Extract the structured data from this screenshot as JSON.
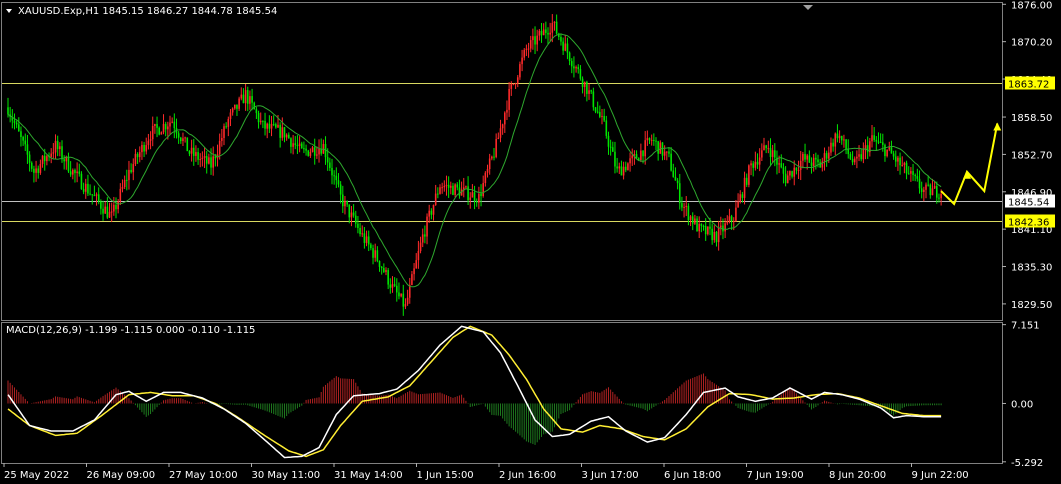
{
  "header": {
    "symbol_line": "XAUUSD.Exp,H1  1845.15 1846.27 1844.78 1845.54",
    "indicator_line": "MACD(12,26,9) -1.199 -1.115 0.000 -0.110 -1.115"
  },
  "colors": {
    "background": "#000000",
    "bull": "#ff2a2a",
    "bear": "#00e600",
    "ma": "#2ea82e",
    "level": "#d8d860",
    "current": "#c0c0c0",
    "arrow": "#ffff00",
    "macd_line": "#ffffff",
    "signal_line": "#ffee33",
    "hist_pos": "#b22222",
    "hist_neg": "#1e7a1e"
  },
  "chart_data": {
    "type": "candlestick",
    "price_axis": {
      "ticks": [
        "1876.00",
        "1870.20",
        "1864.40",
        "1858.50",
        "1852.70",
        "1846.90",
        "1841.10",
        "1835.30",
        "1829.50"
      ],
      "ylim": [
        1827.0,
        1876.2
      ]
    },
    "macd_axis": {
      "ticks": [
        "7.151",
        "0.00",
        "-5.292"
      ],
      "ylim": [
        -5.4,
        7.3
      ]
    },
    "time_labels": [
      "25 May 2022",
      "26 May 09:00",
      "27 May 10:00",
      "30 May 11:00",
      "31 May 14:00",
      "1 Jun 15:00",
      "2 Jun 16:00",
      "3 Jun 17:00",
      "6 Jun 18:00",
      "7 Jun 19:00",
      "8 Jun 20:00",
      "9 Jun 22:00"
    ],
    "levels": [
      {
        "value": 1863.72,
        "label": "1863.72",
        "style": "yellow-box"
      },
      {
        "value": 1845.54,
        "label": "1845.54",
        "style": "white-box"
      },
      {
        "value": 1842.36,
        "label": "1842.36",
        "style": "yellow-box"
      }
    ],
    "close_path": [
      [
        0,
        1860
      ],
      [
        6,
        1855
      ],
      [
        12,
        1850
      ],
      [
        22,
        1854
      ],
      [
        30,
        1850
      ],
      [
        40,
        1846
      ],
      [
        48,
        1843
      ],
      [
        56,
        1850
      ],
      [
        66,
        1856
      ],
      [
        76,
        1858
      ],
      [
        84,
        1853
      ],
      [
        94,
        1851
      ],
      [
        102,
        1858
      ],
      [
        110,
        1862
      ],
      [
        118,
        1857
      ],
      [
        128,
        1856
      ],
      [
        136,
        1853
      ],
      [
        146,
        1854
      ],
      [
        154,
        1846
      ],
      [
        164,
        1840
      ],
      [
        172,
        1836
      ],
      [
        178,
        1832
      ],
      [
        184,
        1829
      ],
      [
        192,
        1840
      ],
      [
        200,
        1848
      ],
      [
        210,
        1847
      ],
      [
        218,
        1846
      ],
      [
        226,
        1854
      ],
      [
        232,
        1862
      ],
      [
        240,
        1869
      ],
      [
        246,
        1871
      ],
      [
        252,
        1873
      ],
      [
        260,
        1868
      ],
      [
        268,
        1863
      ],
      [
        276,
        1857
      ],
      [
        282,
        1850
      ],
      [
        290,
        1852
      ],
      [
        298,
        1855
      ],
      [
        306,
        1852
      ],
      [
        312,
        1845
      ],
      [
        320,
        1841
      ],
      [
        328,
        1840
      ],
      [
        336,
        1843
      ],
      [
        344,
        1851
      ],
      [
        352,
        1854
      ],
      [
        360,
        1849
      ],
      [
        368,
        1852
      ],
      [
        376,
        1851
      ],
      [
        384,
        1856
      ],
      [
        392,
        1851
      ],
      [
        400,
        1855
      ],
      [
        408,
        1853
      ],
      [
        416,
        1850
      ],
      [
        424,
        1847
      ],
      [
        432,
        1847
      ]
    ],
    "projection_path": [
      [
        432,
        1847
      ],
      [
        438,
        1845
      ],
      [
        444,
        1850
      ],
      [
        452,
        1847
      ],
      [
        458,
        1857.5
      ]
    ],
    "macd": {
      "line": [
        [
          0,
          0.8
        ],
        [
          10,
          -2.0
        ],
        [
          20,
          -2.5
        ],
        [
          30,
          -2.5
        ],
        [
          40,
          -1.5
        ],
        [
          50,
          0.8
        ],
        [
          56,
          1.1
        ],
        [
          64,
          0.2
        ],
        [
          72,
          1.0
        ],
        [
          80,
          1.0
        ],
        [
          90,
          0.5
        ],
        [
          100,
          -0.5
        ],
        [
          110,
          -1.8
        ],
        [
          120,
          -3.5
        ],
        [
          128,
          -4.9
        ],
        [
          136,
          -4.8
        ],
        [
          144,
          -4.0
        ],
        [
          152,
          -1.0
        ],
        [
          160,
          0.7
        ],
        [
          172,
          0.9
        ],
        [
          180,
          1.3
        ],
        [
          190,
          3.0
        ],
        [
          200,
          5.3
        ],
        [
          210,
          7.0
        ],
        [
          220,
          6.5
        ],
        [
          228,
          4.6
        ],
        [
          236,
          1.6
        ],
        [
          244,
          -1.5
        ],
        [
          252,
          -3.0
        ],
        [
          260,
          -2.8
        ],
        [
          270,
          -1.6
        ],
        [
          278,
          -1.2
        ],
        [
          286,
          -2.5
        ],
        [
          296,
          -3.5
        ],
        [
          304,
          -3.1
        ],
        [
          314,
          -1.0
        ],
        [
          322,
          1.0
        ],
        [
          332,
          1.4
        ],
        [
          338,
          0.6
        ],
        [
          346,
          0.2
        ],
        [
          354,
          0.5
        ],
        [
          362,
          1.4
        ],
        [
          372,
          0.4
        ],
        [
          378,
          1.0
        ],
        [
          386,
          0.8
        ],
        [
          394,
          0.4
        ],
        [
          404,
          -0.4
        ],
        [
          410,
          -1.3
        ],
        [
          416,
          -1.1
        ],
        [
          424,
          -1.2
        ],
        [
          432,
          -1.2
        ]
      ],
      "signal": [
        [
          0,
          -0.5
        ],
        [
          10,
          -2.0
        ],
        [
          22,
          -2.9
        ],
        [
          32,
          -2.7
        ],
        [
          44,
          -1.0
        ],
        [
          56,
          0.8
        ],
        [
          66,
          1.0
        ],
        [
          76,
          0.7
        ],
        [
          86,
          0.7
        ],
        [
          96,
          0.0
        ],
        [
          106,
          -1.2
        ],
        [
          118,
          -2.8
        ],
        [
          130,
          -4.3
        ],
        [
          138,
          -4.8
        ],
        [
          146,
          -4.2
        ],
        [
          154,
          -2.0
        ],
        [
          164,
          0.2
        ],
        [
          176,
          0.6
        ],
        [
          186,
          1.6
        ],
        [
          196,
          3.8
        ],
        [
          206,
          6.0
        ],
        [
          214,
          7.0
        ],
        [
          224,
          6.2
        ],
        [
          232,
          4.4
        ],
        [
          240,
          2.2
        ],
        [
          248,
          -0.5
        ],
        [
          256,
          -2.3
        ],
        [
          266,
          -2.6
        ],
        [
          274,
          -2.0
        ],
        [
          284,
          -2.3
        ],
        [
          294,
          -3.0
        ],
        [
          304,
          -3.3
        ],
        [
          314,
          -2.3
        ],
        [
          324,
          -0.3
        ],
        [
          334,
          0.9
        ],
        [
          344,
          0.8
        ],
        [
          354,
          0.4
        ],
        [
          364,
          0.5
        ],
        [
          374,
          0.8
        ],
        [
          384,
          0.9
        ],
        [
          394,
          0.5
        ],
        [
          404,
          -0.2
        ],
        [
          414,
          -0.9
        ],
        [
          424,
          -1.1
        ],
        [
          432,
          -1.1
        ]
      ]
    }
  }
}
